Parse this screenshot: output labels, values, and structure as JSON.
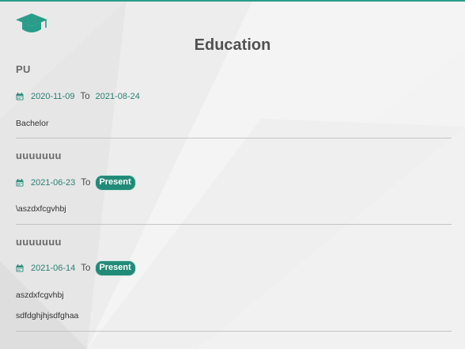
{
  "page": {
    "title": "Education",
    "accent_color": "#2a9d8a",
    "logo_icon": "graduation-cap-icon"
  },
  "entries": [
    {
      "name": "PU",
      "start": "2020-11-09",
      "to_label": "To",
      "end": "2021-08-24",
      "end_is_badge": false,
      "lines": [
        "Bachelor"
      ]
    },
    {
      "name": "uuuuuuu",
      "start": "2021-06-23",
      "to_label": "To",
      "end": "Present",
      "end_is_badge": true,
      "lines": [
        "\\aszdxfcgvhbj"
      ]
    },
    {
      "name": "uuuuuuu",
      "start": "2021-06-14",
      "to_label": "To",
      "end": "Present",
      "end_is_badge": true,
      "lines": [
        "aszdxfcgvhbj",
        "sdfdghjhjsdfghaa"
      ]
    }
  ]
}
